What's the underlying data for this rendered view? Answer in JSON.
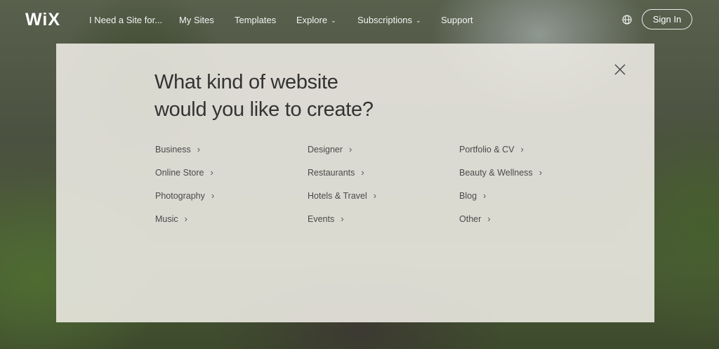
{
  "nav": {
    "logo": "WiX",
    "items": [
      {
        "label": "I Need a Site for...",
        "has_chevron": false
      },
      {
        "label": "My Sites",
        "has_chevron": false
      },
      {
        "label": "Templates",
        "has_chevron": false
      },
      {
        "label": "Explore",
        "has_chevron": true
      },
      {
        "label": "Subscriptions",
        "has_chevron": true
      },
      {
        "label": "Support",
        "has_chevron": false
      }
    ],
    "sign_in": "Sign In",
    "globe_icon": "globe-icon"
  },
  "modal": {
    "headline_line1": "What kind of website",
    "headline_line2": "would you like to create?",
    "close_icon": "close-icon",
    "columns": [
      [
        "Business",
        "Online Store",
        "Photography",
        "Music"
      ],
      [
        "Designer",
        "Restaurants",
        "Hotels & Travel",
        "Events"
      ],
      [
        "Portfolio & CV",
        "Beauty & Wellness",
        "Blog",
        "Other"
      ]
    ],
    "arrow_glyph": "›"
  }
}
